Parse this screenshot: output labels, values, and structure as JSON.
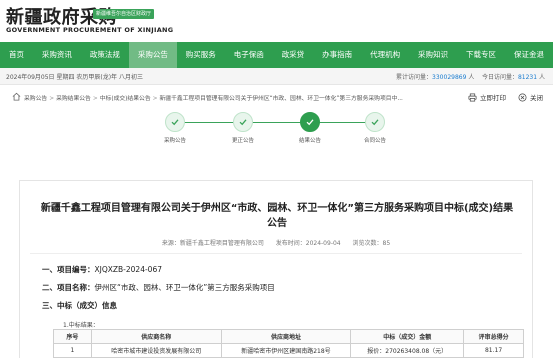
{
  "header": {
    "logo_cn": "新疆政府采购",
    "logo_en": "GOVERNMENT PROCUREMENT OF XINJIANG",
    "region_tag": "新疆维吾尔自治区财政厅"
  },
  "nav": {
    "items": [
      {
        "label": "首页",
        "active": false
      },
      {
        "label": "采购资讯",
        "active": false
      },
      {
        "label": "政策法规",
        "active": false
      },
      {
        "label": "采购公告",
        "active": true
      },
      {
        "label": "购买服务",
        "active": false
      },
      {
        "label": "电子保函",
        "active": false
      },
      {
        "label": "政采贷",
        "active": false
      },
      {
        "label": "办事指南",
        "active": false
      },
      {
        "label": "代理机构",
        "active": false
      },
      {
        "label": "采购知识",
        "active": false
      },
      {
        "label": "下载专区",
        "active": false
      },
      {
        "label": "保证金退",
        "active": false
      }
    ]
  },
  "infobar": {
    "date": "2024年09月05日 星期四 农历甲辰(龙)年 八月初三",
    "total_label": "累计访问量：",
    "total_value": "330029869",
    "total_unit": " 人",
    "today_label": "今日访问量：",
    "today_value": "81231",
    "today_unit": " 人"
  },
  "breadcrumb": {
    "items": [
      "采购公告",
      "采购结果公告",
      "中标(成交)结果公告",
      "新疆千鑫工程项目管理有限公司关于伊州区“市政、园林、环卫一体化”第三方服务采购项目中..."
    ],
    "separator": ">"
  },
  "actions": {
    "print": "立即打印",
    "close": "关闭"
  },
  "progress": {
    "steps": [
      {
        "label": "采购公告",
        "current": false
      },
      {
        "label": "更正公告",
        "current": false
      },
      {
        "label": "结果公告",
        "current": true
      },
      {
        "label": "合同公告",
        "current": false
      }
    ]
  },
  "article": {
    "title": "新疆千鑫工程项目管理有限公司关于伊州区“市政、园林、环卫一体化”第三方服务采购项目中标(成交)结果公告",
    "meta": {
      "source": "来源：新疆千鑫工程项目管理有限公司",
      "published": "发布时间：2024-09-04",
      "views": "浏览次数：85"
    },
    "sections": {
      "s1_label": "一、项目编号：",
      "s1_value": "XJQXZB-2024-067",
      "s2_label": "二、项目名称：",
      "s2_value": "伊州区“市政、园林、环卫一体化”第三方服务采购项目",
      "s3_label": "三、中标（成交）信息",
      "sub_label": "1.中标结果："
    },
    "table": {
      "headers": [
        "序号",
        "供应商名称",
        "供应商地址",
        "中标（成交）金额",
        "评审总得分"
      ],
      "rows": [
        [
          "1",
          "哈密市城市建设投资发展有限公司",
          "新疆哈密市伊州区建国南路218号",
          "报价：270263408.08（元）",
          "81.17"
        ]
      ]
    }
  },
  "colors": {
    "nav_green": "#2e9e4f",
    "nav_active": "#71bb85",
    "stat_blue": "#1a7ccf"
  }
}
